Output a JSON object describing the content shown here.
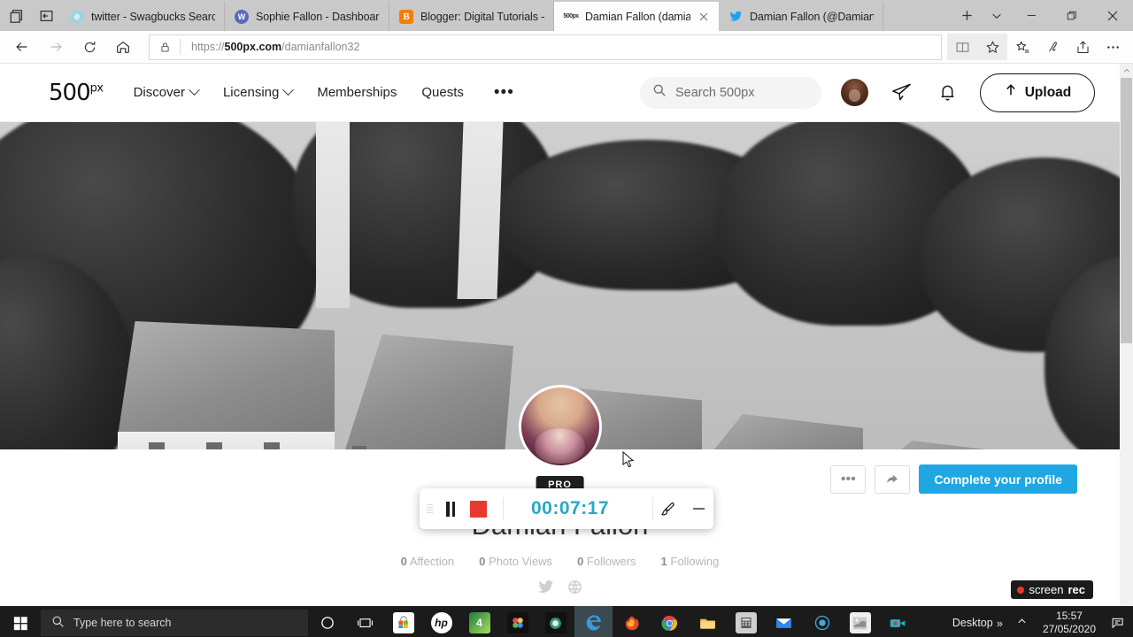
{
  "browser": {
    "tabs": [
      {
        "title": "twitter - Swagbucks Search",
        "icon": "swagbucks-favicon",
        "active": false
      },
      {
        "title": "Sophie Fallon - Dashboard -",
        "icon": "wordpress-favicon",
        "active": false
      },
      {
        "title": "Blogger: Digital Tutorials - (",
        "icon": "blogger-favicon",
        "active": false
      },
      {
        "title": "Damian Fallon (damianf",
        "icon": "500px-favicon",
        "active": true
      },
      {
        "title": "Damian Fallon (@DamianFa",
        "icon": "twitter-favicon",
        "active": false
      }
    ],
    "new_tab_label": "+",
    "url": {
      "protocol": "https://",
      "host": "500px.com",
      "path": "/damianfallon32",
      "full": "https://500px.com/damianfallon32"
    },
    "window_controls": {
      "minimize": "–",
      "maximize": "❐",
      "close": "✕"
    }
  },
  "site": {
    "logo": "500",
    "logo_sup": "px",
    "nav": [
      {
        "label": "Discover",
        "has_caret": true
      },
      {
        "label": "Licensing",
        "has_caret": true
      },
      {
        "label": "Memberships",
        "has_caret": false
      },
      {
        "label": "Quests",
        "has_caret": false
      }
    ],
    "more_label": "•••",
    "search_placeholder": "Search 500px",
    "search_value": "",
    "upload_label": "Upload"
  },
  "profile": {
    "name": "Damian Fallon",
    "badge": "PRO",
    "stats": [
      {
        "value": "0",
        "label": "Affection"
      },
      {
        "value": "0",
        "label": "Photo Views"
      },
      {
        "value": "0",
        "label": "Followers"
      },
      {
        "value": "1",
        "label": "Following"
      }
    ],
    "socials": [
      "twitter-icon",
      "website-icon"
    ],
    "actions": {
      "more": "•••",
      "share": "share-icon",
      "cta_label": "Complete your profile"
    },
    "cta_color": "#1ea7e1"
  },
  "recorder": {
    "time": "00:07:17",
    "time_color": "#27a9c6",
    "stop_color": "#e8392f",
    "pause_label": "pause",
    "stop_label": "stop",
    "brush_label": "annotate",
    "minimize_label": "minimize"
  },
  "watermark": {
    "text_light": "screen",
    "text_bold": "rec"
  },
  "taskbar": {
    "search_placeholder": "Type here to search",
    "apps": [
      {
        "name": "cortana-icon"
      },
      {
        "name": "task-view-icon"
      },
      {
        "name": "microsoft-store-icon",
        "glyph": ""
      },
      {
        "name": "hp-icon",
        "glyph": "hp"
      },
      {
        "name": "excel-icon",
        "glyph": "4"
      },
      {
        "name": "photos-icon",
        "glyph": ""
      },
      {
        "name": "media-app-icon",
        "glyph": ""
      },
      {
        "name": "edge-icon",
        "glyph": "e"
      },
      {
        "name": "firefox-icon",
        "glyph": ""
      },
      {
        "name": "chrome-icon",
        "glyph": ""
      },
      {
        "name": "file-explorer-icon",
        "glyph": ""
      },
      {
        "name": "calculator-icon",
        "glyph": ""
      },
      {
        "name": "mail-icon",
        "glyph": ""
      },
      {
        "name": "record-app-icon",
        "glyph": ""
      },
      {
        "name": "paint-icon",
        "glyph": ""
      },
      {
        "name": "screenrec-icon",
        "glyph": ""
      }
    ],
    "desktop_label": "Desktop",
    "time": "15:57",
    "date": "27/05/2020"
  }
}
